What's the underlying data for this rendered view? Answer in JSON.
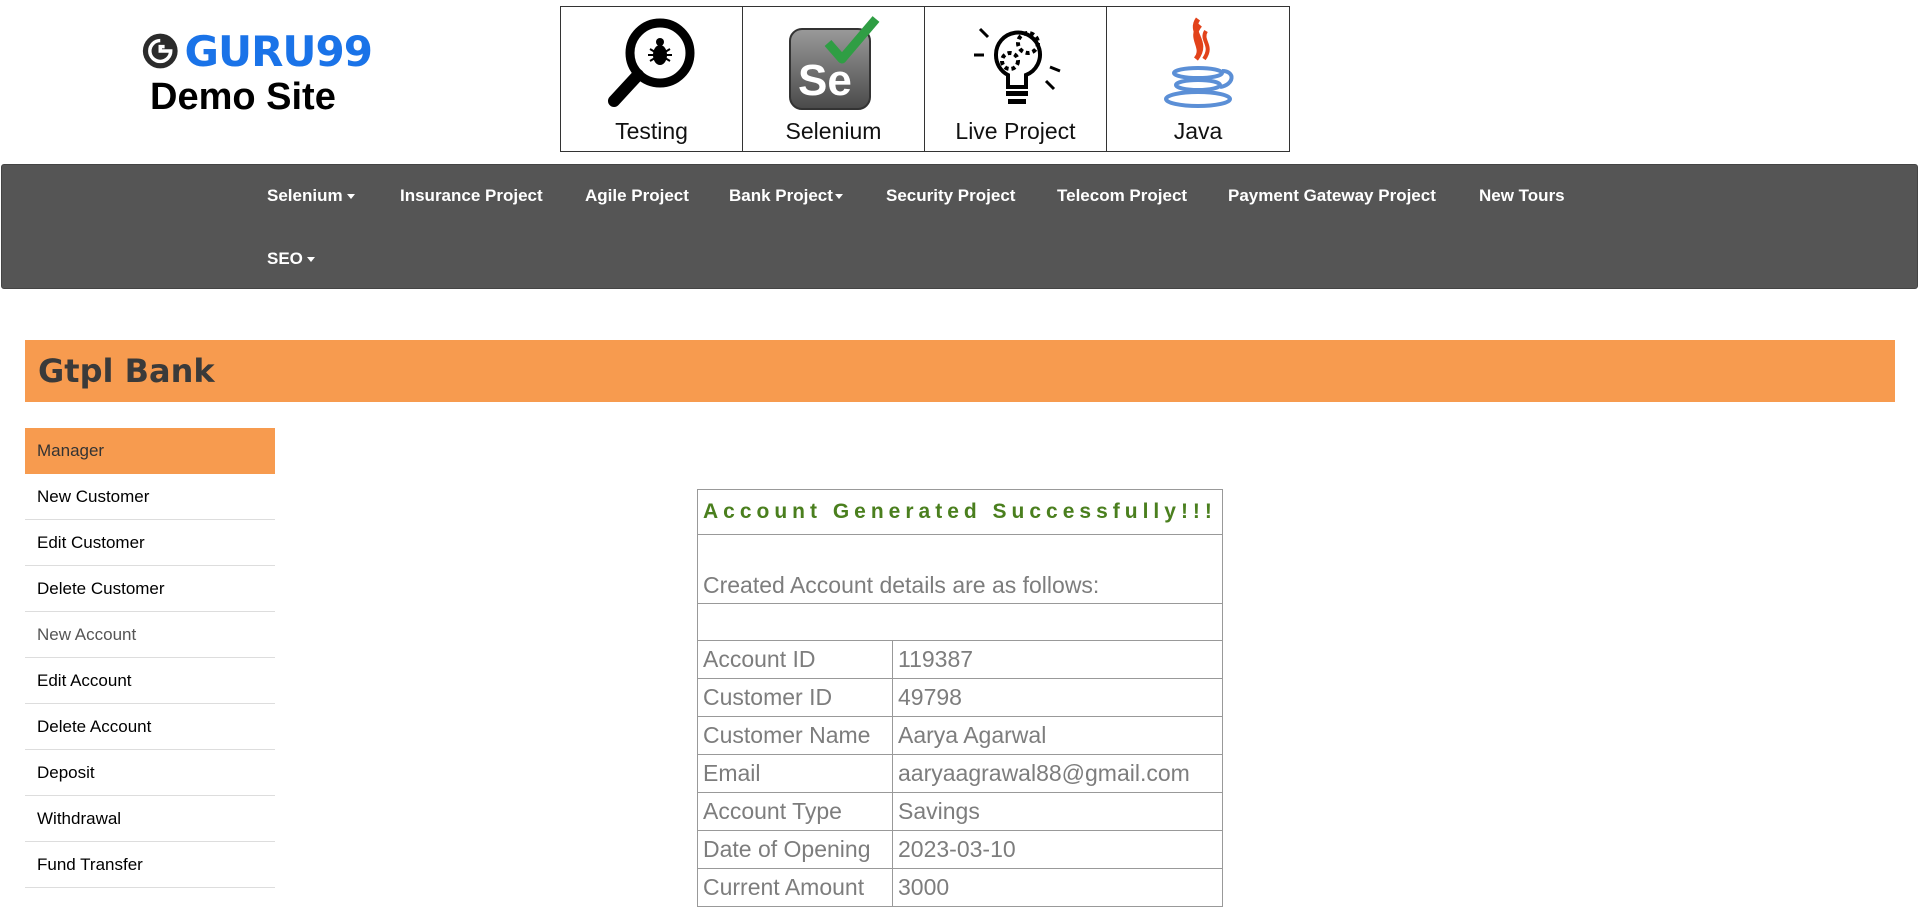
{
  "header": {
    "logo_text": "GURU99",
    "subtitle": "Demo Site",
    "tiles": [
      {
        "label": "Testing",
        "icon": "magnifier-bug-icon"
      },
      {
        "label": "Selenium",
        "icon": "selenium-icon"
      },
      {
        "label": "Live Project",
        "icon": "lightbulb-gears-icon"
      },
      {
        "label": "Java",
        "icon": "java-icon"
      }
    ]
  },
  "nav": {
    "items": [
      "Selenium",
      "Insurance Project",
      "Agile Project",
      "Bank Project",
      "Security Project",
      "Telecom Project",
      "Payment Gateway Project",
      "New Tours",
      "SEO"
    ]
  },
  "bank": {
    "title": "Gtpl Bank"
  },
  "sidebar": {
    "items": [
      "Manager",
      "New Customer",
      "Edit Customer",
      "Delete Customer",
      "New Account",
      "Edit Account",
      "Delete Account",
      "Deposit",
      "Withdrawal",
      "Fund Transfer"
    ]
  },
  "account": {
    "success": "Account Generated Successfully!!!",
    "description": "Created Account details are as follows:",
    "rows": [
      {
        "label": "Account ID",
        "value": "119387"
      },
      {
        "label": "Customer ID",
        "value": "49798"
      },
      {
        "label": "Customer Name",
        "value": "Aarya Agarwal"
      },
      {
        "label": "Email",
        "value": "aaryaagrawal88@gmail.com"
      },
      {
        "label": "Account Type",
        "value": "Savings"
      },
      {
        "label": "Date of Opening",
        "value": "2023-03-10"
      },
      {
        "label": "Current Amount",
        "value": "3000"
      }
    ]
  },
  "colors": {
    "accent": "#f79b4f",
    "nav_bg": "#555555",
    "success": "#4a7f1e",
    "logo_blue": "#1a73e8"
  }
}
